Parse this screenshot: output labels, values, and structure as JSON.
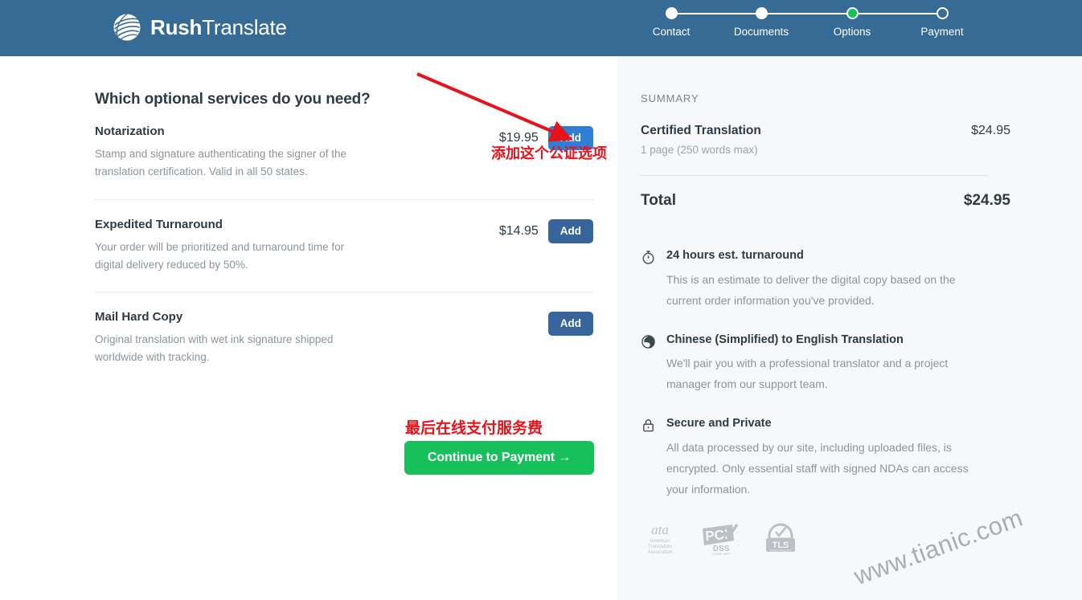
{
  "brand": {
    "name_bold": "Rush",
    "name_light": "Translate",
    "logo_icon": "globe-swirl-logo"
  },
  "stepper": {
    "steps": [
      {
        "label": "Contact",
        "state": "completed"
      },
      {
        "label": "Documents",
        "state": "completed"
      },
      {
        "label": "Options",
        "state": "current"
      },
      {
        "label": "Payment",
        "state": "upcoming"
      }
    ],
    "current_color": "#16c252"
  },
  "main": {
    "section_title": "Which optional services do you need?",
    "services": [
      {
        "name": "Notarization",
        "description": "Stamp and signature authenticating the signer of the translation certification. Valid in all 50 states.",
        "price": "$19.95",
        "add_label": "Add",
        "highlighted": true
      },
      {
        "name": "Expedited Turnaround",
        "description": "Your order will be prioritized and turnaround time for digital delivery reduced by 50%.",
        "price": "$14.95",
        "add_label": "Add",
        "highlighted": false
      },
      {
        "name": "Mail Hard Copy",
        "description": "Original translation with wet ink signature shipped worldwide with tracking.",
        "price": "",
        "add_label": "Add",
        "highlighted": false
      }
    ],
    "continue_label": "Continue to Payment  →"
  },
  "annotations": {
    "arrow_note": "添加这个公证选项",
    "cta_note": "最后在线支付服务费",
    "color": "#e8131a"
  },
  "summary": {
    "heading": "SUMMARY",
    "line_item": {
      "name": "Certified Translation",
      "sub": "1 page (250 words max)",
      "amount": "$24.95"
    },
    "total_label": "Total",
    "total_amount": "$24.95",
    "features": [
      {
        "icon": "stopwatch-icon",
        "title": "24 hours est. turnaround",
        "description": "This is an estimate to deliver the digital copy based on the current order information you've provided."
      },
      {
        "icon": "globe-icon",
        "title": "Chinese (Simplified) to English Translation",
        "description": "We'll pair you with a professional translator and a project manager from our support team."
      },
      {
        "icon": "lock-icon",
        "title": "Secure and Private",
        "description": "All data processed by our site, including uploaded files, is encrypted. Only essential staff with signed NDAs can access your information."
      }
    ],
    "badges": [
      {
        "icon": "ata-badge-icon",
        "label": "ata",
        "sub": "American Translators Association"
      },
      {
        "icon": "pci-dss-badge-icon",
        "label": "PCI",
        "sub": "DSS COMPLIANT"
      },
      {
        "icon": "tls-badge-icon",
        "label": "TLS",
        "sub": "Secure Shopping"
      }
    ]
  },
  "watermark": {
    "text": "www.tianic.com"
  }
}
